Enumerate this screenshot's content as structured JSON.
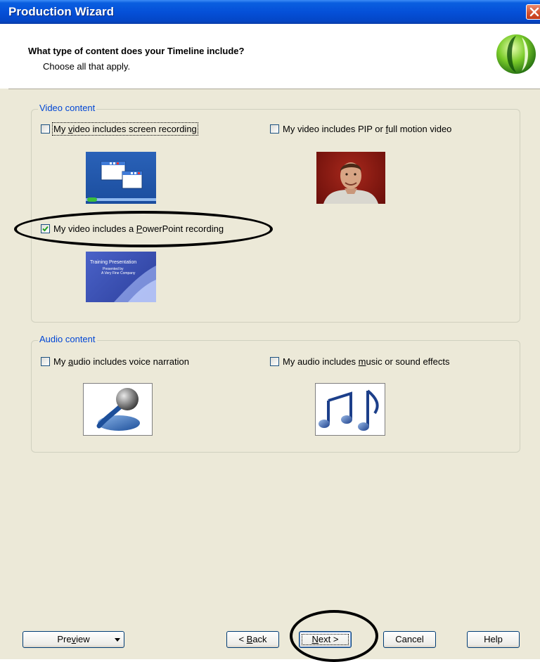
{
  "window": {
    "title": "Production Wizard"
  },
  "header": {
    "title": "What type of content does your Timeline include?",
    "subtitle": "Choose all that apply."
  },
  "video_group": {
    "label": "Video content",
    "screen_recording": {
      "pre": "My ",
      "accel": "v",
      "post": "ideo includes screen recording",
      "checked": false,
      "icon": "screen-windows-icon"
    },
    "pip_video": {
      "pre": "My video includes PIP or ",
      "accel": "f",
      "post": "ull motion video",
      "checked": false,
      "icon": "person-photo"
    },
    "powerpoint": {
      "pre": "My video includes a ",
      "accel": "P",
      "post": "owerPoint recording",
      "checked": true,
      "icon": "slide-thumbnail"
    },
    "slide_thumb": {
      "title": "Training Presentation",
      "line1": "Presented by",
      "line2": "A Very Fine Company"
    }
  },
  "audio_group": {
    "label": "Audio content",
    "voice": {
      "pre": "My ",
      "accel": "a",
      "post": "udio includes voice narration",
      "checked": false,
      "icon": "microphone-icon"
    },
    "music": {
      "pre": "My audio includes ",
      "accel": "m",
      "post": "usic or sound effects",
      "checked": false,
      "icon": "music-notes-icon"
    }
  },
  "buttons": {
    "preview": {
      "pre": "Pre",
      "accel": "v",
      "post": "iew"
    },
    "back": {
      "pre": "< ",
      "accel": "B",
      "post": "ack"
    },
    "next": {
      "pre": "",
      "accel": "N",
      "post": "ext >"
    },
    "cancel": "Cancel",
    "help": "Help"
  },
  "colors": {
    "accent": "#0046d5",
    "titlebar": "#0550d8",
    "face": "#ece9d8"
  }
}
